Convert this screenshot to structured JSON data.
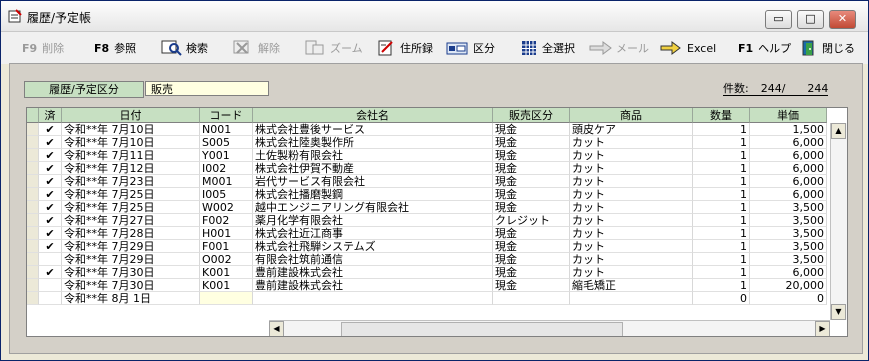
{
  "window": {
    "title": "履歴/予定帳",
    "controls": {
      "minimize": "▭",
      "maximize": "□",
      "close": "✕"
    }
  },
  "toolbar": {
    "delete": {
      "key": "F9",
      "label": "削除"
    },
    "reference": {
      "key": "F8",
      "label": "参照"
    },
    "search": {
      "label": "検索"
    },
    "release": {
      "label": "解除"
    },
    "zoom": {
      "label": "ズーム"
    },
    "address_book": {
      "label": "住所録"
    },
    "category": {
      "label": "区分"
    },
    "select_all": {
      "label": "全選択"
    },
    "mail": {
      "label": "メール"
    },
    "excel": {
      "label": "Excel"
    },
    "help": {
      "key": "F1",
      "label": "ヘルプ"
    },
    "close": {
      "label": "閉じる"
    }
  },
  "filter": {
    "label": "履歴/予定区分",
    "value": "販売"
  },
  "count": {
    "label": "件数:",
    "value": "244/　　244"
  },
  "table": {
    "headers": [
      "済",
      "日付",
      "コード",
      "会社名",
      "販売区分",
      "商品",
      "数量",
      "単価"
    ],
    "rows": [
      {
        "done": "✔",
        "date": "令和**年 7月10日",
        "code": "N001",
        "company": "株式会社豊後サービス",
        "type": "現金",
        "product": "頭皮ケア",
        "qty": "1",
        "price": "1,500"
      },
      {
        "done": "✔",
        "date": "令和**年 7月10日",
        "code": "S005",
        "company": "株式会社陸奥製作所",
        "type": "現金",
        "product": "カット",
        "qty": "1",
        "price": "6,000"
      },
      {
        "done": "✔",
        "date": "令和**年 7月11日",
        "code": "Y001",
        "company": "土佐製粉有限会社",
        "type": "現金",
        "product": "カット",
        "qty": "1",
        "price": "6,000"
      },
      {
        "done": "✔",
        "date": "令和**年 7月12日",
        "code": "I002",
        "company": "株式会社伊賀不動産",
        "type": "現金",
        "product": "カット",
        "qty": "1",
        "price": "6,000"
      },
      {
        "done": "✔",
        "date": "令和**年 7月23日",
        "code": "M001",
        "company": "岩代サービス有限会社",
        "type": "現金",
        "product": "カット",
        "qty": "1",
        "price": "6,000"
      },
      {
        "done": "✔",
        "date": "令和**年 7月25日",
        "code": "I005",
        "company": "株式会社播磨製鋼",
        "type": "現金",
        "product": "カット",
        "qty": "1",
        "price": "6,000"
      },
      {
        "done": "✔",
        "date": "令和**年 7月25日",
        "code": "W002",
        "company": "越中エンジニアリング有限会社",
        "type": "現金",
        "product": "カット",
        "qty": "1",
        "price": "3,500"
      },
      {
        "done": "✔",
        "date": "令和**年 7月27日",
        "code": "F002",
        "company": "薬月化学有限会社",
        "type": "クレジット",
        "product": "カット",
        "qty": "1",
        "price": "3,500"
      },
      {
        "done": "✔",
        "date": "令和**年 7月28日",
        "code": "H001",
        "company": "株式会社近江商事",
        "type": "現金",
        "product": "カット",
        "qty": "1",
        "price": "3,500"
      },
      {
        "done": "✔",
        "date": "令和**年 7月29日",
        "code": "F001",
        "company": "株式会社飛騨システムズ",
        "type": "現金",
        "product": "カット",
        "qty": "1",
        "price": "3,500"
      },
      {
        "done": "",
        "date": "令和**年 7月29日",
        "code": "O002",
        "company": "有限会社筑前通信",
        "type": "現金",
        "product": "カット",
        "qty": "1",
        "price": "3,500"
      },
      {
        "done": "✔",
        "date": "令和**年 7月30日",
        "code": "K001",
        "company": "豊前建設株式会社",
        "type": "現金",
        "product": "カット",
        "qty": "1",
        "price": "6,000"
      },
      {
        "done": "",
        "date": "令和**年 7月30日",
        "code": "K001",
        "company": "豊前建設株式会社",
        "type": "現金",
        "product": "縮毛矯正",
        "qty": "1",
        "price": "20,000"
      },
      {
        "done": "",
        "date": "令和**年 8月 1日",
        "code": "",
        "company": "",
        "type": "",
        "product": "",
        "qty": "0",
        "price": "0"
      }
    ]
  }
}
